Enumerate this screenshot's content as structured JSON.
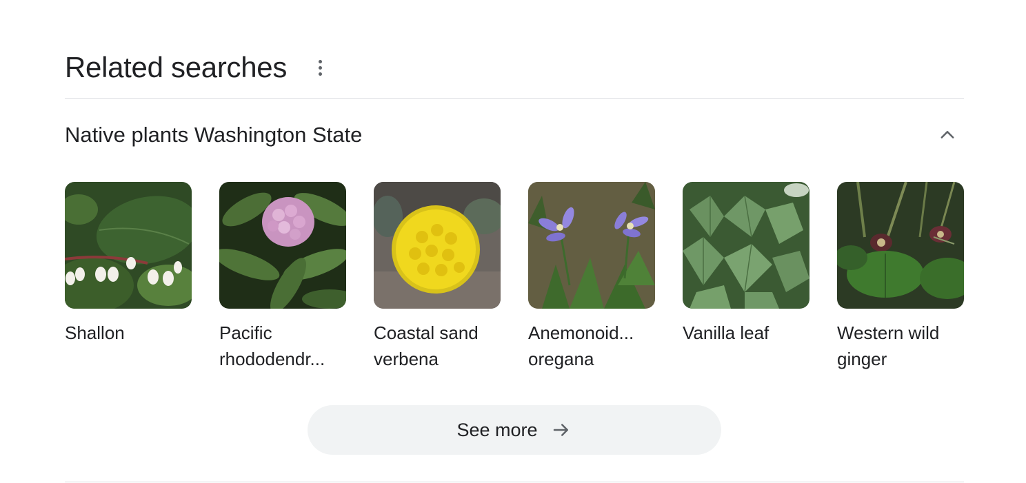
{
  "header": {
    "title": "Related searches",
    "more_icon": "more-vert-icon"
  },
  "group": {
    "title": "Native plants Washington State",
    "toggle_icon": "chevron-up-icon"
  },
  "cards": [
    {
      "label": "Shallon"
    },
    {
      "label": "Pacific rhododendr..."
    },
    {
      "label": "Coastal sand verbena"
    },
    {
      "label": "Anemonoid... oregana"
    },
    {
      "label": "Vanilla leaf"
    },
    {
      "label": "Western wild ginger"
    }
  ],
  "see_more": {
    "label": "See more",
    "icon": "arrow-right-icon"
  }
}
